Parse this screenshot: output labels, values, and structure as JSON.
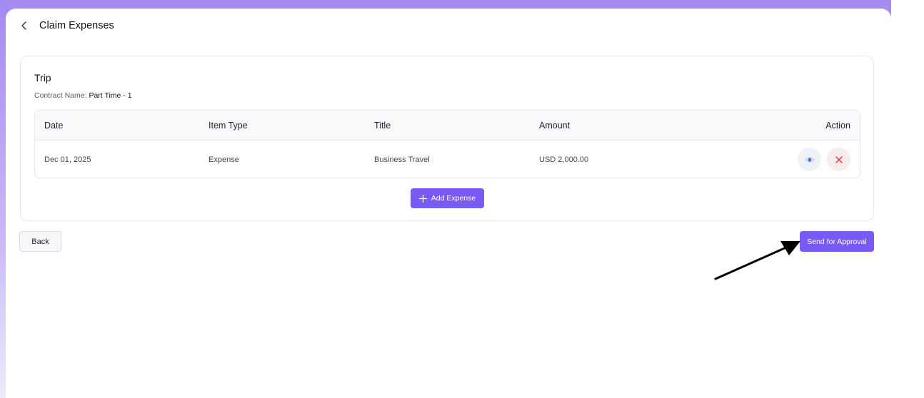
{
  "header": {
    "title": "Claim Expenses",
    "back_icon": "chevron-left-icon"
  },
  "card": {
    "title": "Trip",
    "contract_label": "Contract Name:",
    "contract_value": "Part Time - 1"
  },
  "table": {
    "columns": [
      "Date",
      "Item Type",
      "Title",
      "Amount",
      "Action"
    ],
    "rows": [
      {
        "date": "Dec 01, 2025",
        "item_type": "Expense",
        "title": "Business Travel",
        "amount": "USD 2,000.00",
        "actions": [
          "eye-icon",
          "close-icon"
        ]
      }
    ]
  },
  "buttons": {
    "add_expense": "Add Expense",
    "back": "Back",
    "send_for_approval": "Send for Approval"
  },
  "colors": {
    "accent": "#7a5af5",
    "view_icon": "#3b6fe0",
    "delete_icon": "#d9363e",
    "frame_gradient_top": "#a48af2"
  },
  "annotation": {
    "arrow_icon": "pointer-arrow-icon"
  }
}
